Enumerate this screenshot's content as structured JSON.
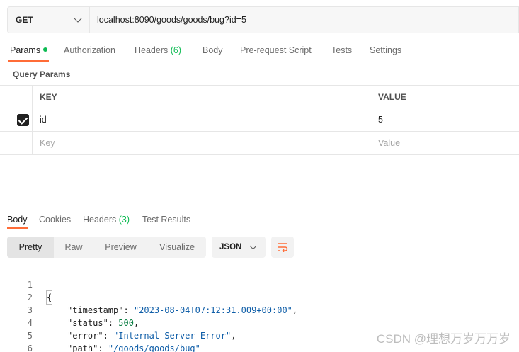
{
  "request": {
    "method": "GET",
    "url": "localhost:8090/goods/goods/bug?id=5"
  },
  "request_tabs": {
    "params": "Params",
    "authorization": "Authorization",
    "headers": "Headers",
    "headers_count": "(6)",
    "body": "Body",
    "prerequest": "Pre-request Script",
    "tests": "Tests",
    "settings": "Settings"
  },
  "query_params": {
    "title": "Query Params",
    "key_header": "KEY",
    "value_header": "VALUE",
    "rows": [
      {
        "key": "id",
        "value": "5",
        "checked": true
      }
    ],
    "key_placeholder": "Key",
    "value_placeholder": "Value"
  },
  "response_tabs": {
    "body": "Body",
    "cookies": "Cookies",
    "headers": "Headers",
    "headers_count": "(3)",
    "test_results": "Test Results"
  },
  "view_modes": {
    "pretty": "Pretty",
    "raw": "Raw",
    "preview": "Preview",
    "visualize": "Visualize"
  },
  "format": "JSON",
  "code": {
    "line_numbers": [
      "1",
      "2",
      "3",
      "4",
      "5",
      "6"
    ],
    "open": "{",
    "close": "}",
    "timestamp_key": "\"timestamp\"",
    "timestamp_value": "\"2023-08-04T07:12:31.009+00:00\"",
    "status_key": "\"status\"",
    "status_value": "500",
    "error_key": "\"error\"",
    "error_value": "\"Internal Server Error\"",
    "path_key": "\"path\"",
    "path_quote": "\"",
    "path_value": "/goods/goods/bug"
  },
  "watermark": "CSDN @理想万岁万万岁",
  "colors": {
    "accent": "#ff6c37",
    "success": "#0cbb52",
    "string": "#0f5ea8",
    "number": "#0b7e43"
  }
}
